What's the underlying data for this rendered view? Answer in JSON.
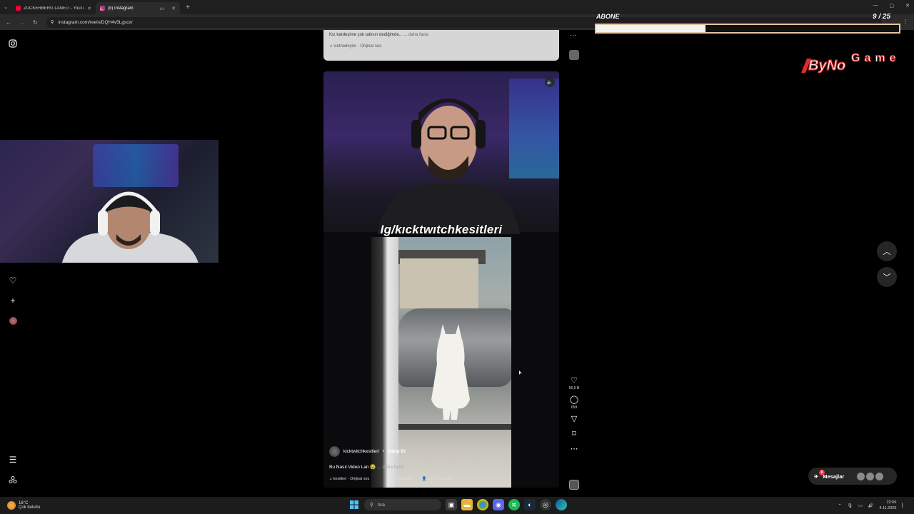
{
  "browser": {
    "tabs": [
      {
        "title": "ZUCKERBERG LANETİ - YouTube",
        "favicon_color": "#ff0033",
        "active": false
      },
      {
        "title": "(8) Instagram",
        "favicon_color": "#d62976",
        "active": true
      }
    ],
    "url": "instagram.com/reels/DQH4v5Lgscx/"
  },
  "stream_overlay": {
    "subscribe_label": "ABONE",
    "subscribe_count": "9 / 25",
    "subscribe_progress": 0.36,
    "logo_text": "ByNoGame",
    "logo_text_primary": "ByNo",
    "logo_text_secondary": "Game",
    "accent": "#e42b2b"
  },
  "previous_post": {
    "caption": "Kız kardeşime çok tatlısın dediğimde...",
    "more": "... daha fazla",
    "audio": "vietnedeyim · Orijinal ses"
  },
  "reel": {
    "overlay_text": "Ig/kıcktwıtchkesitleri",
    "username": "kicktwitchkesitleri",
    "separator": "•",
    "follow_label": "Takip Et",
    "caption": "Bu Nasıl Video Lan",
    "caption_emoji": "😭",
    "more": "... daha fazla",
    "audio": "kesitleri · Orijinal ses",
    "tag_1": "kicktwitch",
    "tag_2": "aynısınemalar"
  },
  "actions": {
    "likes": "56,5 B",
    "comments": "659"
  },
  "messages": {
    "label": "Mesajlar",
    "badge": "8"
  },
  "taskbar": {
    "temperature": "16°C",
    "weather": "Çok bulutlu",
    "search_placeholder": "Ara",
    "time": "22:06",
    "date": "4.11.2025"
  }
}
